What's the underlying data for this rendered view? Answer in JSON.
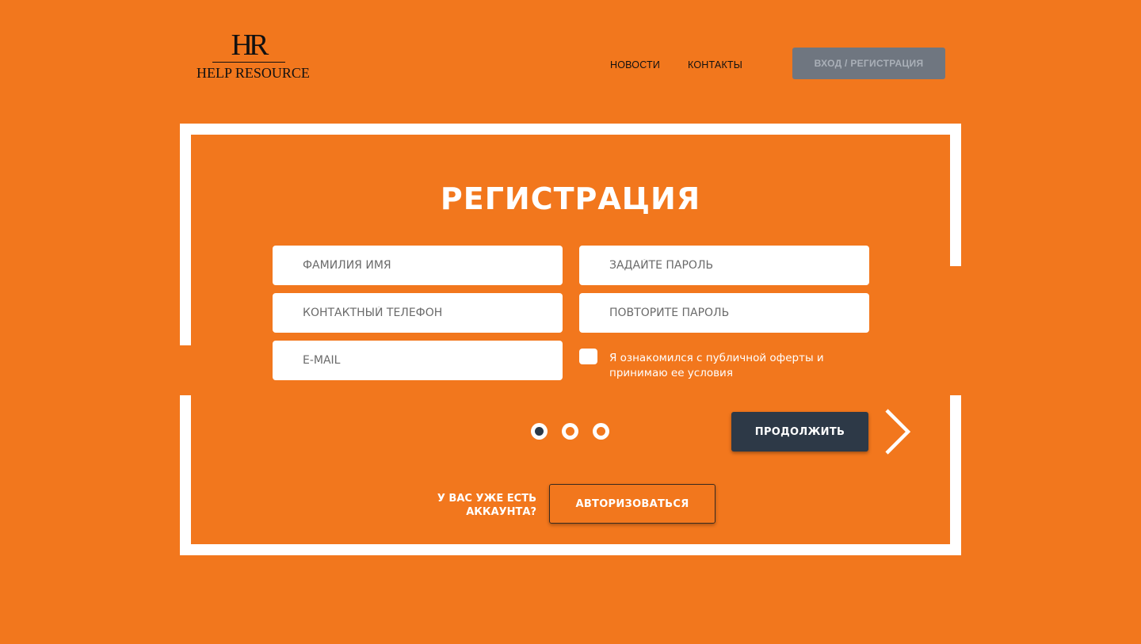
{
  "header": {
    "logo": {
      "monogram": "HR",
      "name": "HELP RESOURCE"
    },
    "nav": [
      {
        "label": "НОВОСТИ"
      },
      {
        "label": "КОНТАКТЫ"
      }
    ],
    "login_button": "ВХОД / РЕГИСТРАЦИЯ"
  },
  "form": {
    "title": "РЕГИСТРАЦИЯ",
    "fields": {
      "full_name": {
        "placeholder": "ФАМИЛИЯ ИМЯ",
        "value": ""
      },
      "phone": {
        "placeholder": "КОНТАКТНЫЙ ТЕЛЕФОН",
        "value": ""
      },
      "email": {
        "placeholder": "E-MAIL",
        "value": ""
      },
      "password": {
        "placeholder": "ЗАДАЙТЕ ПАРОЛЬ",
        "value": ""
      },
      "password_repeat": {
        "placeholder": "ПОВТОРИТЕ ПАРОЛЬ",
        "value": ""
      }
    },
    "agreement": {
      "label": "Я ознакомился с публичной оферты и принимаю ее условия",
      "checked": false
    },
    "pager": {
      "total": 3,
      "current": 1
    },
    "continue_button": "ПРОДОЛЖИТЬ",
    "next_icon": "chevron-right-icon"
  },
  "footer": {
    "have_account_text": "У ВАС УЖЕ ЕСТЬ АККАУНТА?",
    "authorize_button": "АВТОРИЗОВАТЬСЯ"
  },
  "colors": {
    "background": "#f2771d",
    "frame": "#ffffff",
    "primary_button": "#2d3947",
    "login_button": "#6f7680",
    "login_button_text": "#aab0b8"
  }
}
